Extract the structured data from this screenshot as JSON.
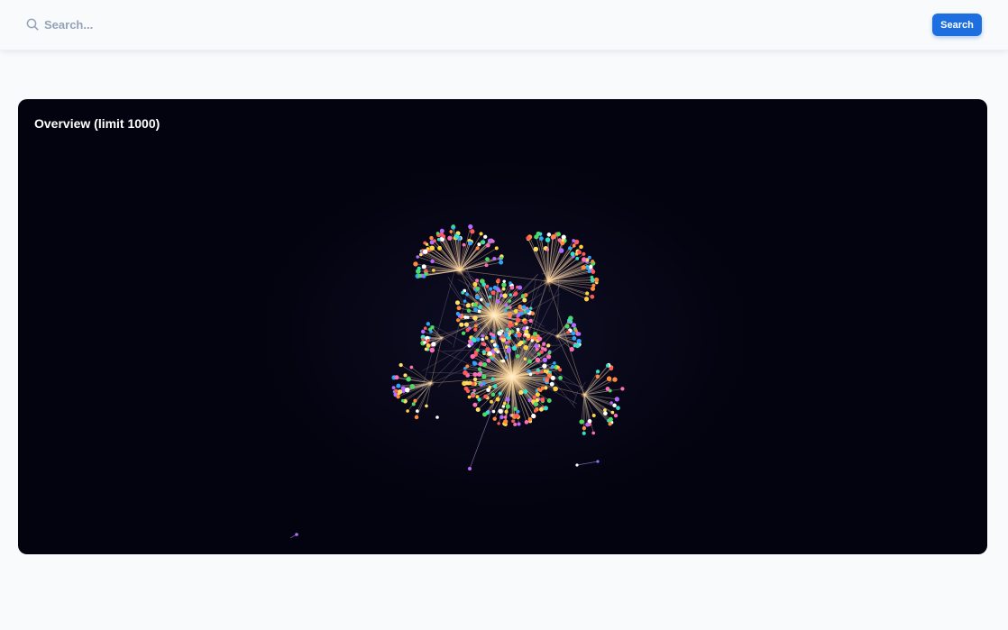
{
  "search": {
    "placeholder": "Search...",
    "button_label": "Search"
  },
  "overview": {
    "title": "Overview (limit 1000)"
  },
  "colors": {
    "accent": "#1d6fe0",
    "graph_background": "#03030f",
    "node_palette": [
      "#ff5a5a",
      "#ffd23f",
      "#4cd964",
      "#2fa4ff",
      "#b56bff",
      "#ff8a3d",
      "#ffffff",
      "#ff6fb5",
      "#34e0c8",
      "#ffe066"
    ]
  }
}
